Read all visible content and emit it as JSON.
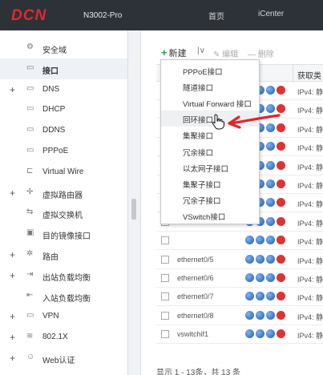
{
  "header": {
    "logo": "DCN",
    "model": "N3002-Pro",
    "nav": [
      {
        "label": "首页"
      },
      {
        "label": "iCenter"
      }
    ]
  },
  "sidebar": {
    "items": [
      {
        "label": "安全域",
        "icon": "security-zone-icon",
        "expandable": false,
        "active": false
      },
      {
        "label": "接口",
        "icon": "interface-icon",
        "expandable": false,
        "active": true
      },
      {
        "label": "DNS",
        "icon": "dns-icon",
        "expandable": true,
        "active": false
      },
      {
        "label": "DHCP",
        "icon": "dhcp-icon",
        "expandable": false,
        "active": false
      },
      {
        "label": "DDNS",
        "icon": "ddns-icon",
        "expandable": false,
        "active": false
      },
      {
        "label": "PPPoE",
        "icon": "pppoe-icon",
        "expandable": false,
        "active": false
      },
      {
        "label": "Virtual Wire",
        "icon": "virtual-wire-icon",
        "expandable": false,
        "active": false
      },
      {
        "label": "虚拟路由器",
        "icon": "virtual-router-icon",
        "expandable": true,
        "active": false
      },
      {
        "label": "虚拟交换机",
        "icon": "virtual-switch-icon",
        "expandable": false,
        "active": false
      },
      {
        "label": "目的镜像接口",
        "icon": "mirror-interface-icon",
        "expandable": false,
        "active": false
      },
      {
        "label": "路由",
        "icon": "route-icon",
        "expandable": true,
        "active": false
      },
      {
        "label": "出站负载均衡",
        "icon": "outbound-lb-icon",
        "expandable": true,
        "active": false
      },
      {
        "label": "入站负载均衡",
        "icon": "inbound-lb-icon",
        "expandable": false,
        "active": false
      },
      {
        "label": "VPN",
        "icon": "vpn-icon",
        "expandable": true,
        "active": false
      },
      {
        "label": "802.1X",
        "icon": "wifi-icon",
        "expandable": true,
        "active": false
      },
      {
        "label": "Web认证",
        "icon": "web-auth-icon",
        "expandable": true,
        "active": false
      }
    ]
  },
  "toolbar": {
    "new_label": "新建",
    "caret": "|∨",
    "edit_label": "编辑",
    "delete_label": "删除"
  },
  "table": {
    "header_right": "获取类",
    "rows": [
      {
        "name": "",
        "type": "IPv4: 静"
      },
      {
        "name": "",
        "type": "IPv4: 静"
      },
      {
        "name": "",
        "type": "IPv4: 静"
      },
      {
        "name": "",
        "type": "IPv4: 静"
      },
      {
        "name": "",
        "type": "IPv4: 静"
      },
      {
        "name": "",
        "type": "IPv4: 静"
      },
      {
        "name": "",
        "type": "IPv4: 静"
      },
      {
        "name": "",
        "type": "IPv4: 静"
      },
      {
        "name": "",
        "type": "IPv4: 静"
      },
      {
        "name": "ethernet0/5",
        "type": "IPv4: 静"
      },
      {
        "name": "ethernet0/6",
        "type": "IPv4: 静"
      },
      {
        "name": "ethernet0/7",
        "type": "IPv4: 静"
      },
      {
        "name": "ethernet0/8",
        "type": "IPv4: 静"
      },
      {
        "name": "vswitchif1",
        "type": "IPv4: 静"
      }
    ],
    "footer": "显示 1 - 13条，共 13 条"
  },
  "dropdown": {
    "items": [
      {
        "label": "PPPoE接口",
        "hover": false
      },
      {
        "label": "隧道接口",
        "hover": false
      },
      {
        "label": "Virtual Forward 接口",
        "hover": false
      },
      {
        "label": "回环接口",
        "hover": true
      },
      {
        "label": "集聚接口",
        "hover": false
      },
      {
        "label": "冗余接口",
        "hover": false
      },
      {
        "label": "以太网子接口",
        "hover": false
      },
      {
        "label": "集聚子接口",
        "hover": false
      },
      {
        "label": "冗余子接口",
        "hover": false
      },
      {
        "label": "VSwitch接口",
        "hover": false
      }
    ]
  },
  "colors": {
    "header_bg": "#2d3138",
    "logo": "#e02a2a",
    "accent_green": "#2e9a4a",
    "annotation_red": "#e0262b"
  }
}
